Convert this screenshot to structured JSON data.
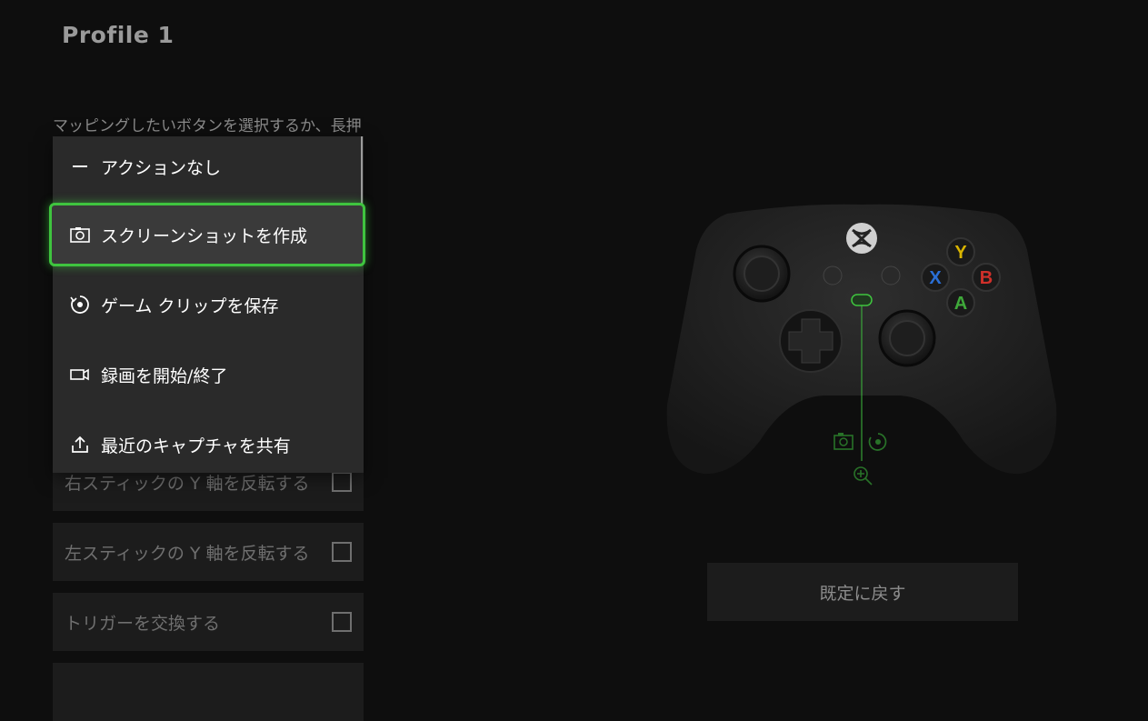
{
  "page": {
    "title": "Profile 1",
    "hint": "マッピングしたいボタンを選択するか、長押"
  },
  "menu": {
    "items": [
      {
        "label": "アクションなし",
        "icon": "dash-icon"
      },
      {
        "label": "スクリーンショットを作成",
        "icon": "camera-icon"
      },
      {
        "label": "ゲーム クリップを保存",
        "icon": "record-circle-icon"
      },
      {
        "label": "録画を開始/終了",
        "icon": "video-camera-icon"
      },
      {
        "label": "最近のキャプチャを共有",
        "icon": "share-upload-icon"
      }
    ],
    "selected_index": 1
  },
  "options": [
    {
      "label": "右スティックの Y 軸を反転する",
      "checked": false
    },
    {
      "label": "左スティックの Y 軸を反転する",
      "checked": false
    },
    {
      "label": "トリガーを交換する",
      "checked": false
    }
  ],
  "controller": {
    "face_buttons": {
      "y": "Y",
      "x": "X",
      "b": "B",
      "a": "A"
    },
    "share_mapping_icons": [
      "camera-icon",
      "record-circle-icon",
      "zoom-icon"
    ]
  },
  "reset_button": {
    "label": "既定に戻す"
  },
  "colors": {
    "accent_green": "#3fc43f",
    "button_y": "#d9b400",
    "button_x": "#2a6fd6",
    "button_b": "#d0302a",
    "button_a": "#3fa93a"
  }
}
